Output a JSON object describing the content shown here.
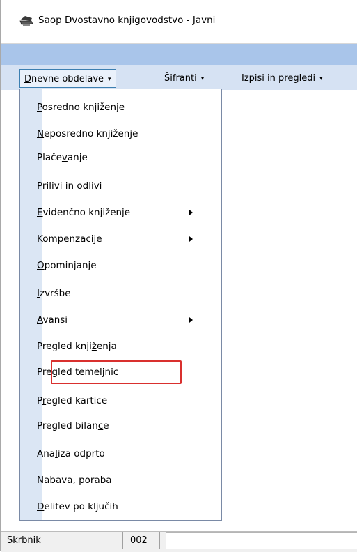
{
  "window": {
    "title": "Saop Dvostavno knjigovodstvo - Javni",
    "icon": "printer-icon"
  },
  "menubar": {
    "items": [
      {
        "pre": "",
        "u": "D",
        "post": "nevne obdelave",
        "arrow": "▾"
      },
      {
        "pre": "Ši",
        "u": "f",
        "post": "ranti",
        "arrow": "▾"
      },
      {
        "pre": "",
        "u": "I",
        "post": "zpisi in pregledi",
        "arrow": "▾"
      }
    ]
  },
  "dropdown": {
    "items": [
      {
        "pre": "",
        "u": "P",
        "post": "osredno knjiženje"
      },
      {
        "pre": "",
        "u": "N",
        "post": "eposredno knjiženje"
      },
      {
        "pre": "Plače",
        "u": "v",
        "post": "anje"
      },
      {
        "pre": "Prilivi in o",
        "u": "d",
        "post": "livi"
      },
      {
        "pre": "",
        "u": "E",
        "post": "videnčno knjiženje"
      },
      {
        "pre": "",
        "u": "K",
        "post": "ompenzacije"
      },
      {
        "pre": "",
        "u": "O",
        "post": "pominjanje"
      },
      {
        "pre": "",
        "u": "I",
        "post": "zvršbe"
      },
      {
        "pre": "",
        "u": "A",
        "post": "vansi"
      },
      {
        "pre": "Pregled knji",
        "u": "ž",
        "post": "enja"
      },
      {
        "pre": "Pregled ",
        "u": "t",
        "post": "emeljnic"
      },
      {
        "pre": "P",
        "u": "r",
        "post": "egled kartice"
      },
      {
        "pre": "Pregled bilan",
        "u": "c",
        "post": "e"
      },
      {
        "pre": "Ana",
        "u": "l",
        "post": "iza odprto"
      },
      {
        "pre": "Na",
        "u": "b",
        "post": "ava, poraba"
      },
      {
        "pre": "",
        "u": "D",
        "post": "elitev po ključih"
      }
    ]
  },
  "statusbar": {
    "user": "Skrbnik",
    "code": "002"
  },
  "colors": {
    "ribbon": "#a9c5ea",
    "menubar": "#d6e2f3",
    "gutter": "#dbe6f4",
    "highlight_box": "#d9302e"
  }
}
